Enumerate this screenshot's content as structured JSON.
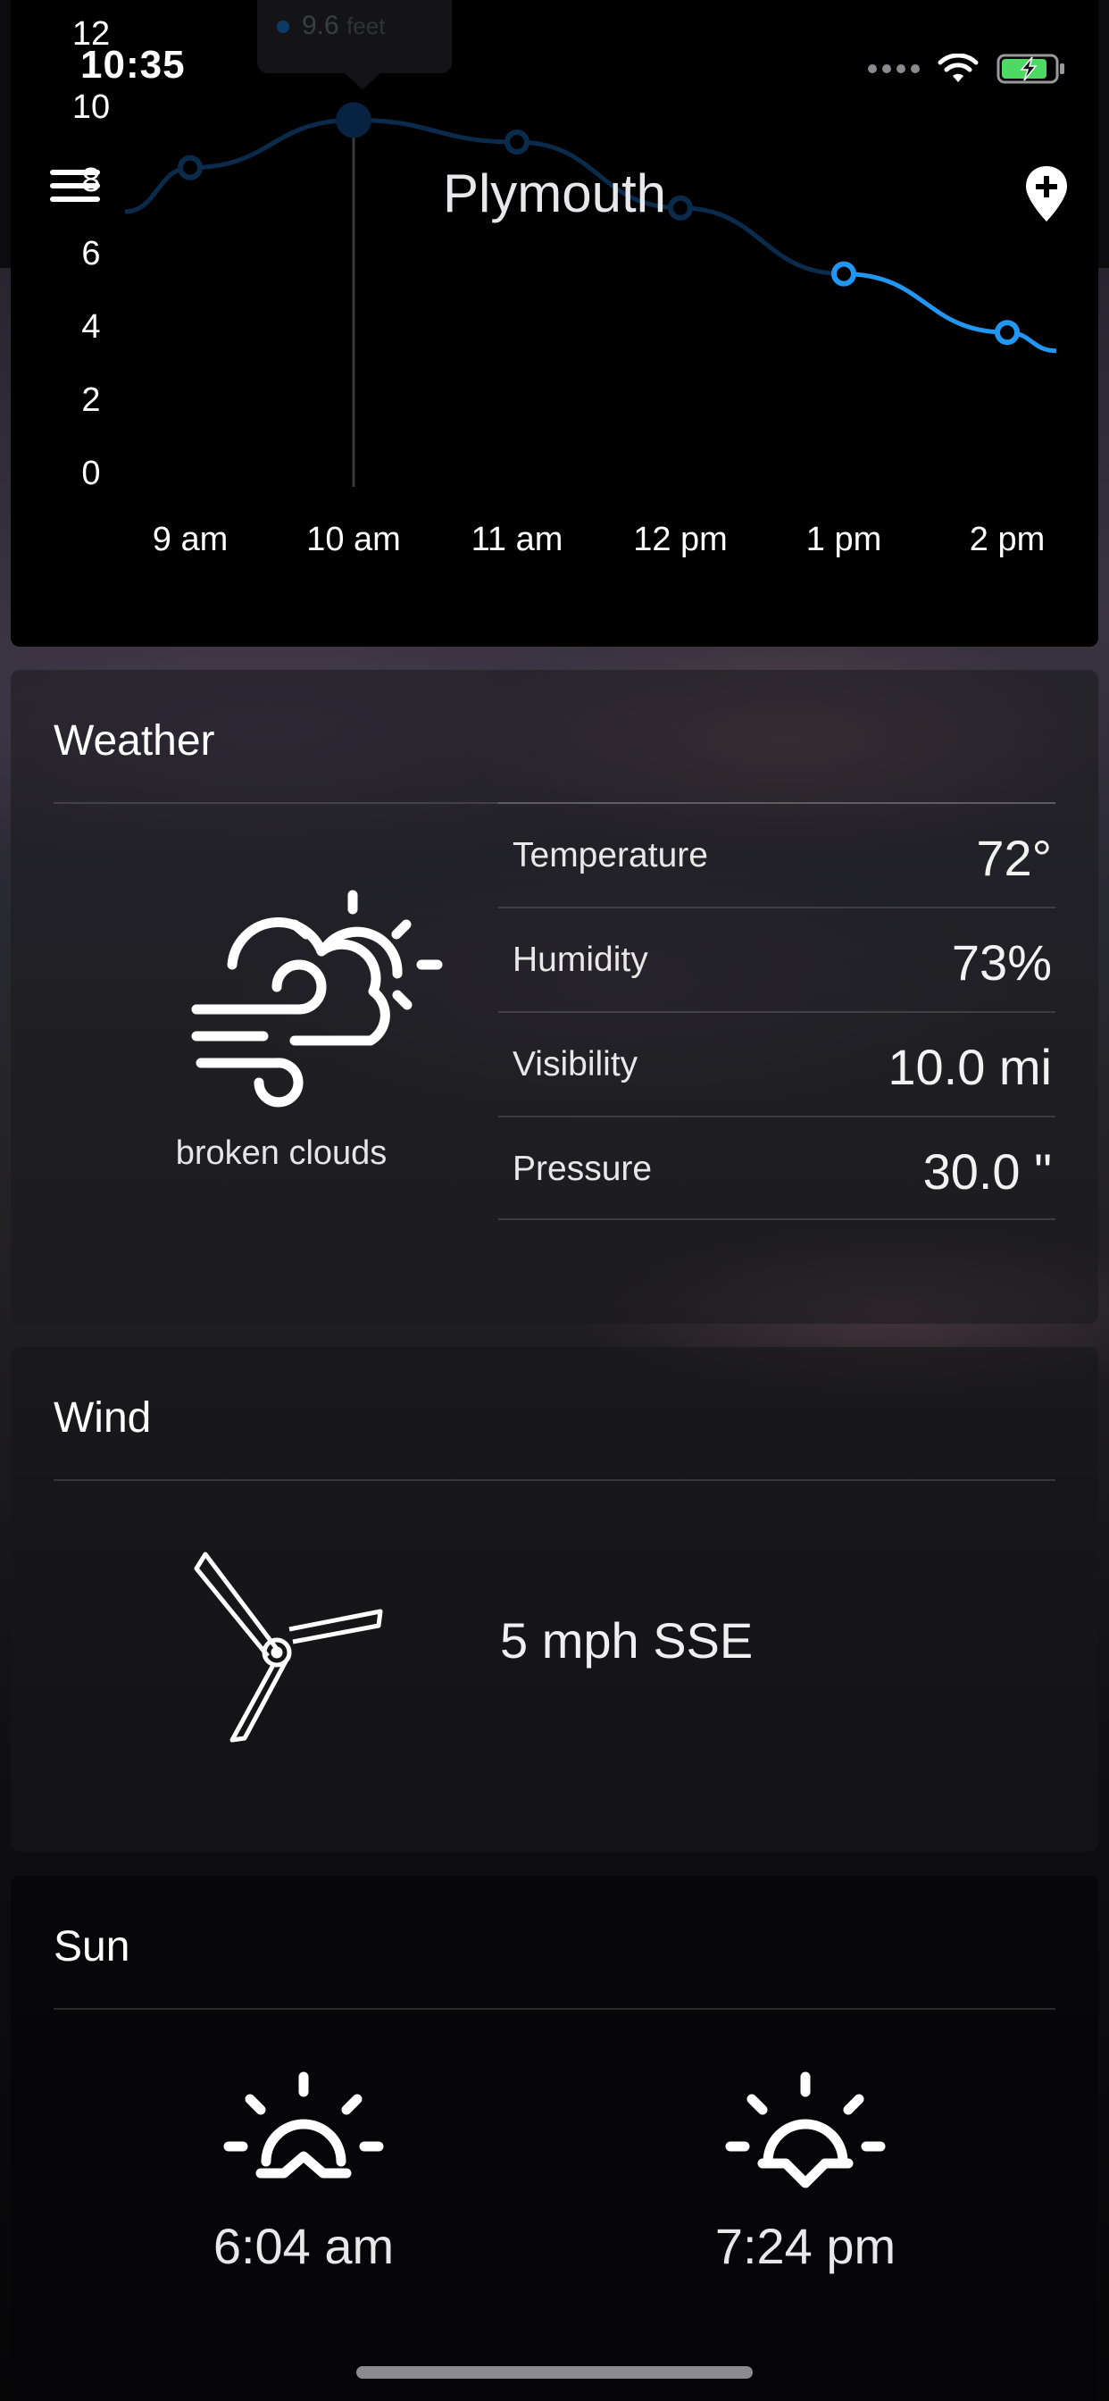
{
  "status_bar": {
    "time": "10:35"
  },
  "header": {
    "city": "Plymouth"
  },
  "chart_data": {
    "type": "line",
    "categories": [
      "9 am",
      "10 am",
      "11 am",
      "12 pm",
      "1 pm",
      "2 pm"
    ],
    "x_ticks": [
      "9 am",
      "10 am",
      "11 am",
      "12 pm",
      "1 pm",
      "2 pm"
    ],
    "y_ticks": [
      "0",
      "2",
      "4",
      "6",
      "8",
      "10",
      "12"
    ],
    "ylim": [
      0,
      12
    ],
    "series": [
      {
        "values": [
          8.3,
          9.6,
          9.0,
          7.2,
          5.4,
          3.8
        ]
      }
    ],
    "selected_index": 1,
    "tooltip": {
      "value": "9.6",
      "unit": "feet"
    },
    "colors": {
      "past": "#0b2b4d",
      "future": "#2196f3"
    }
  },
  "weather": {
    "title": "Weather",
    "icon": "wind-cloud-sun-icon",
    "description": "broken clouds",
    "metrics": [
      {
        "label": "Temperature",
        "value": "72°"
      },
      {
        "label": "Humidity",
        "value": "73%"
      },
      {
        "label": "Visibility",
        "value": "10.0 mi"
      },
      {
        "label": "Pressure",
        "value": "30.0 \""
      }
    ]
  },
  "wind": {
    "title": "Wind",
    "icon": "wind-turbine-icon",
    "value": "5 mph SSE"
  },
  "sun": {
    "title": "Sun",
    "sunrise": {
      "icon": "sunrise-icon",
      "time": "6:04 am"
    },
    "sunset": {
      "icon": "sunset-icon",
      "time": "7:24 pm"
    }
  }
}
